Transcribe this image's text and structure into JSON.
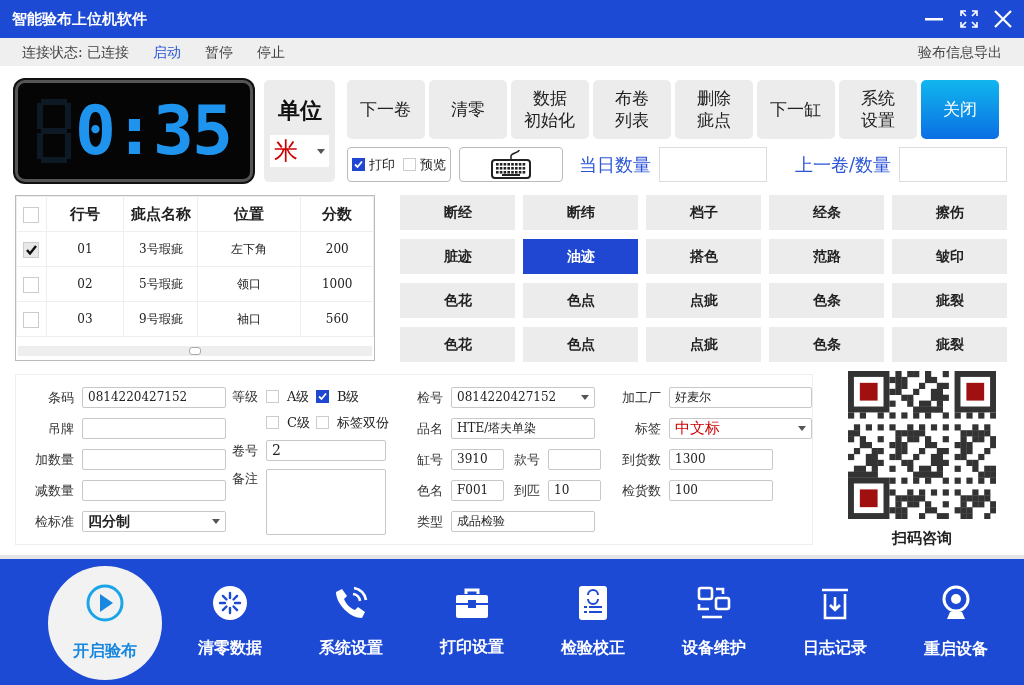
{
  "window": {
    "title": "智能验布上位机软件"
  },
  "menu": {
    "status_label": "连接状态:",
    "status_value": "已连接",
    "items": [
      {
        "label": "启动",
        "selected": true
      },
      {
        "label": "暂停",
        "selected": false
      },
      {
        "label": "停止",
        "selected": false
      }
    ],
    "export": "验布信息导出"
  },
  "display": {
    "reading": "0:35"
  },
  "unit": {
    "label": "单位",
    "value": "米"
  },
  "toolbar": [
    {
      "lines": [
        "下一卷"
      ],
      "kind": "plain"
    },
    {
      "lines": [
        "清零"
      ],
      "kind": "plain"
    },
    {
      "lines": [
        "数据",
        "初始化"
      ],
      "kind": "plain"
    },
    {
      "lines": [
        "布卷",
        "列表"
      ],
      "kind": "plain"
    },
    {
      "lines": [
        "删除",
        "疵点"
      ],
      "kind": "plain"
    },
    {
      "lines": [
        "下一缸"
      ],
      "kind": "plain"
    },
    {
      "lines": [
        "系统",
        "设置"
      ],
      "kind": "plain"
    },
    {
      "lines": [
        "关闭"
      ],
      "kind": "primary"
    }
  ],
  "print_options": [
    {
      "label": "打印",
      "checked": true
    },
    {
      "label": "预览",
      "checked": false
    }
  ],
  "counters": [
    {
      "label": "当日数量"
    },
    {
      "label": "上一卷/数量"
    }
  ],
  "defect_table": {
    "header_checked": false,
    "columns": [
      "行号",
      "疵点名称",
      "位置",
      "分数"
    ],
    "rows": [
      {
        "checked": true,
        "cells": [
          "01",
          "3号瑕疵",
          "左下角",
          "200"
        ]
      },
      {
        "checked": false,
        "cells": [
          "02",
          "5号瑕疵",
          "领口",
          "1000"
        ]
      },
      {
        "checked": false,
        "cells": [
          "03",
          "9号瑕疵",
          "袖口",
          "560"
        ]
      }
    ]
  },
  "defect_buttons": [
    {
      "label": "断经",
      "selected": false
    },
    {
      "label": "断纬",
      "selected": false
    },
    {
      "label": "档子",
      "selected": false
    },
    {
      "label": "经条",
      "selected": false
    },
    {
      "label": "擦伤",
      "selected": false
    },
    {
      "label": "脏迹",
      "selected": false
    },
    {
      "label": "油迹",
      "selected": true
    },
    {
      "label": "搭色",
      "selected": false
    },
    {
      "label": "范路",
      "selected": false
    },
    {
      "label": "皱印",
      "selected": false
    },
    {
      "label": "色花",
      "selected": false
    },
    {
      "label": "色点",
      "selected": false
    },
    {
      "label": "点疵",
      "selected": false
    },
    {
      "label": "色条",
      "selected": false
    },
    {
      "label": "疵裂",
      "selected": false
    },
    {
      "label": "色花",
      "selected": false
    },
    {
      "label": "色点",
      "selected": false
    },
    {
      "label": "点疵",
      "selected": false
    },
    {
      "label": "色条",
      "selected": false
    },
    {
      "label": "疵裂",
      "selected": false
    }
  ],
  "form": {
    "fields": [
      {
        "label": "条码",
        "kind": "input",
        "value": "0814220427152"
      },
      {
        "label": "吊牌",
        "kind": "input"
      },
      {
        "label": "加数量",
        "kind": "input"
      },
      {
        "label": "减数量",
        "kind": "input"
      },
      {
        "label": "检标准",
        "kind": "select",
        "value": "四分制",
        "highlight": false
      }
    ],
    "grade": {
      "label": "等级",
      "options": [
        {
          "label": "A级",
          "checked": false
        },
        {
          "label": "B级",
          "checked": true
        },
        {
          "label": "C级",
          "checked": false
        },
        {
          "label": "标签双份",
          "checked": false
        }
      ]
    },
    "roll": {
      "label": "卷号",
      "value": "2"
    },
    "remark": {
      "label": "备注"
    },
    "info_rows": [
      {
        "left": [
          {
            "label": "检号",
            "kind": "select",
            "value": "0814220427152",
            "highlight": false
          }
        ],
        "right": [
          {
            "label": "加工厂",
            "kind": "input",
            "value": "好麦尔"
          }
        ]
      },
      {
        "left": [
          {
            "label": "品名",
            "kind": "input",
            "value": "HTE/塔夫单染"
          }
        ],
        "right": [
          {
            "label": "标签",
            "kind": "select",
            "value": "中文标",
            "highlight": true
          }
        ]
      },
      {
        "left": [
          {
            "label": "缸号",
            "kind": "short-input",
            "value": "3910"
          },
          {
            "label": "款号",
            "kind": "short-input"
          }
        ],
        "right": [
          {
            "label": "到货数",
            "kind": "medium-input",
            "value": "1300"
          }
        ]
      },
      {
        "left": [
          {
            "label": "色名",
            "kind": "short-input",
            "value": "F001"
          },
          {
            "label": "到匹",
            "kind": "short-input",
            "value": "10"
          }
        ],
        "right": [
          {
            "label": "检货数",
            "kind": "medium-input",
            "value": "100"
          }
        ]
      },
      {
        "left": [
          {
            "label": "类型",
            "kind": "input",
            "value": "成品检验"
          }
        ],
        "right": []
      }
    ]
  },
  "qr": {
    "caption": "扫码咨询"
  },
  "bottom_bar": [
    {
      "label": "开启验布",
      "selected": true
    },
    {
      "label": "清零数据",
      "selected": false
    },
    {
      "label": "系统设置",
      "selected": false
    },
    {
      "label": "打印设置",
      "selected": false
    },
    {
      "label": "检验校正",
      "selected": false
    },
    {
      "label": "设备维护",
      "selected": false
    },
    {
      "label": "日志记录",
      "selected": false
    },
    {
      "label": "重启设备",
      "selected": false
    }
  ]
}
